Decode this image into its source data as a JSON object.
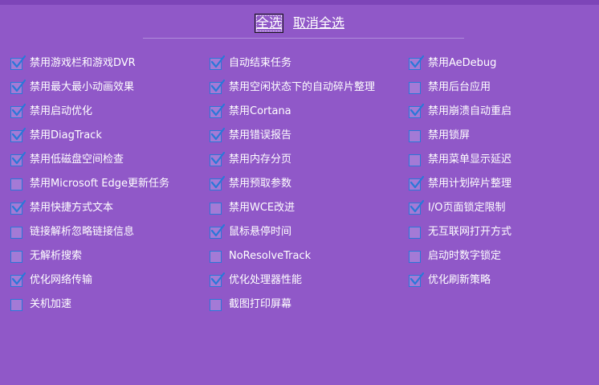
{
  "header": {
    "select_all": "全选",
    "deselect_all": "取消全选"
  },
  "columns": [
    {
      "items": [
        {
          "label": "禁用游戏栏和游戏DVR",
          "checked": true
        },
        {
          "label": "禁用最大最小动画效果",
          "checked": true
        },
        {
          "label": "禁用启动优化",
          "checked": true
        },
        {
          "label": "禁用DiagTrack",
          "checked": true
        },
        {
          "label": "禁用低磁盘空间检查",
          "checked": true
        },
        {
          "label": "禁用Microsoft Edge更新任务",
          "checked": false
        },
        {
          "label": "禁用快捷方式文本",
          "checked": true
        },
        {
          "label": "链接解析忽略链接信息",
          "checked": false
        },
        {
          "label": "无解析搜索",
          "checked": false
        },
        {
          "label": "优化网络传输",
          "checked": true
        },
        {
          "label": "关机加速",
          "checked": false
        }
      ]
    },
    {
      "items": [
        {
          "label": "自动结束任务",
          "checked": true
        },
        {
          "label": "禁用空闲状态下的自动碎片整理",
          "checked": true
        },
        {
          "label": "禁用Cortana",
          "checked": true
        },
        {
          "label": "禁用错误报告",
          "checked": true
        },
        {
          "label": "禁用内存分页",
          "checked": true
        },
        {
          "label": "禁用预取参数",
          "checked": true
        },
        {
          "label": "禁用WCE改进",
          "checked": false
        },
        {
          "label": "鼠标悬停时间",
          "checked": true
        },
        {
          "label": "NoResolveTrack",
          "checked": false
        },
        {
          "label": "优化处理器性能",
          "checked": true
        },
        {
          "label": "截图打印屏幕",
          "checked": false
        }
      ]
    },
    {
      "items": [
        {
          "label": "禁用AeDebug",
          "checked": true
        },
        {
          "label": "禁用后台应用",
          "checked": false
        },
        {
          "label": "禁用崩溃自动重启",
          "checked": true
        },
        {
          "label": "禁用锁屏",
          "checked": false
        },
        {
          "label": "禁用菜单显示延迟",
          "checked": false
        },
        {
          "label": "禁用计划碎片整理",
          "checked": true
        },
        {
          "label": "I/O页面锁定限制",
          "checked": true
        },
        {
          "label": "无互联网打开方式",
          "checked": false
        },
        {
          "label": "启动时数字锁定",
          "checked": false
        },
        {
          "label": "优化刷新策略",
          "checked": true
        }
      ]
    }
  ]
}
